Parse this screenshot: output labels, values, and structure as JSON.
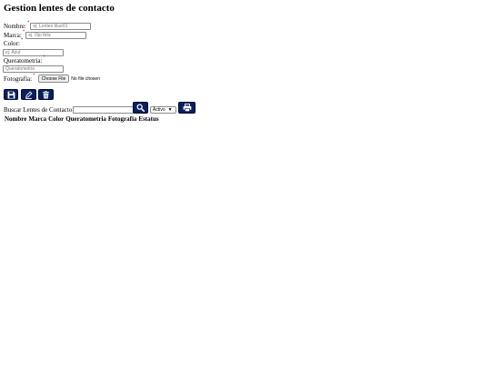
{
  "page": {
    "title": "Gestion lentes de contacto"
  },
  "form": {
    "nombre": {
      "label": "Nombre:",
      "required": "*",
      "placeholder": "ej. Lentes blue01"
    },
    "marca": {
      "label": "Marca:",
      "required": "*",
      "placeholder": "ej. Ojo feliz"
    },
    "color": {
      "label": "Color:",
      "required": "*",
      "placeholder": "ej. Azul"
    },
    "queratometria": {
      "label": "Queratometria:",
      "required": "*",
      "placeholder": "Queratometria"
    },
    "fotografia": {
      "label": "Fotografia:",
      "required": "*",
      "button_label": "Choose File",
      "status": "No file chosen"
    }
  },
  "actions": {
    "save": {
      "icon": "save-icon"
    },
    "edit": {
      "icon": "pencil-icon"
    },
    "delete": {
      "icon": "trash-icon"
    }
  },
  "search": {
    "label": "Buscar Lentes de Contacto",
    "value": "",
    "search_button_icon": "search-icon",
    "status_filter": {
      "selected": "Activo"
    },
    "print_button_icon": "print-icon"
  },
  "table": {
    "headers": [
      "Nombre",
      "Marca",
      "Color",
      "Queratometria",
      "Fotografia",
      "Estatus"
    ],
    "rows": []
  },
  "colors": {
    "button_bg": "#0b1f5c",
    "required": "#d40000"
  }
}
